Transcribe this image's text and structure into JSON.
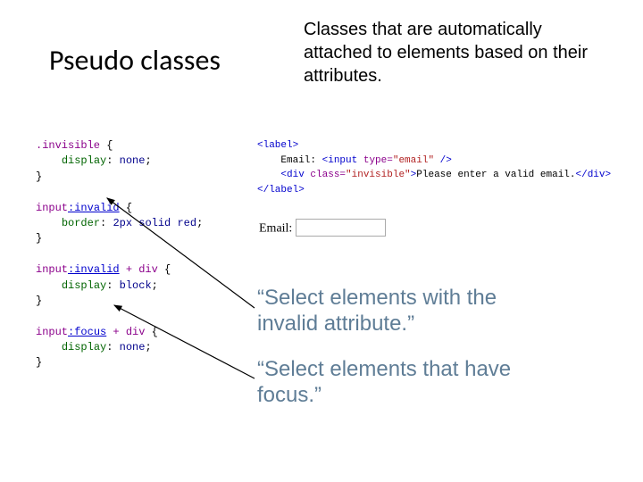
{
  "title": "Pseudo classes",
  "subtitle": "Classes that are automatically attached to elements based on their attributes.",
  "css_block": {
    "rule1": {
      "selector": ".invisible",
      "prop": "display",
      "val": "none"
    },
    "rule2": {
      "selector_base": "input",
      "pseudo": ":invalid",
      "prop": "border",
      "val": "2px solid red"
    },
    "rule3": {
      "selector_base": "input",
      "pseudo": ":invalid",
      "combinator": " + div",
      "prop": "display",
      "val": "block"
    },
    "rule4": {
      "selector_base": "input",
      "pseudo": ":focus",
      "combinator": " + div",
      "prop": "display",
      "val": "none"
    }
  },
  "html_block": {
    "open_label": "<label>",
    "line2_text": "    Email: ",
    "line2_tag_open": "<input ",
    "line2_attr": "type=",
    "line2_str": "\"email\"",
    "line2_tag_close": " />",
    "line3_tag_open": "    <div ",
    "line3_attr": "class=",
    "line3_str": "\"invisible\"",
    "line3_tag_mid": ">",
    "line3_text": "Please enter a valid email.",
    "line3_tag_close": "</div>",
    "close_label": "</label>"
  },
  "rendered": {
    "label": "Email:"
  },
  "quote1": "“Select elements with the invalid attribute.”",
  "quote2": "“Select elements that have focus.”"
}
